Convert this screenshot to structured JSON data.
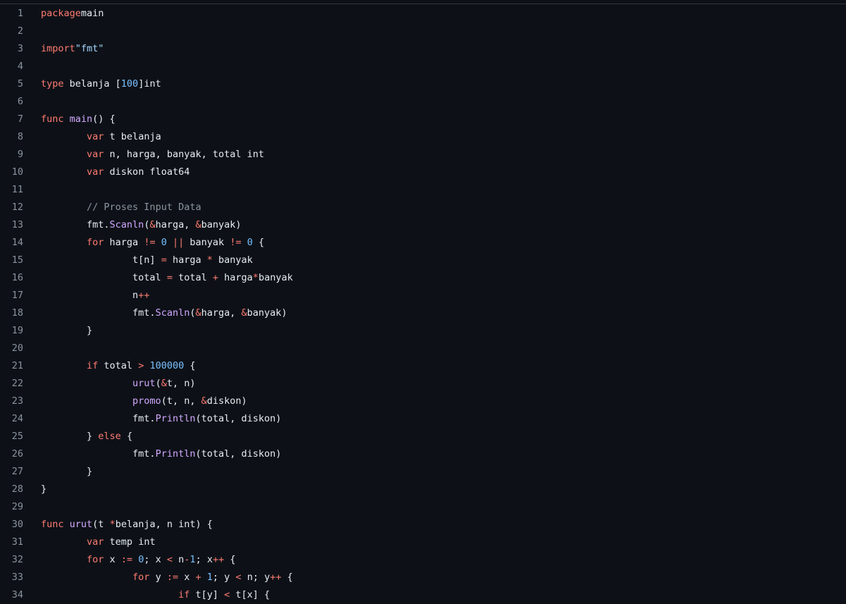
{
  "code": {
    "lines": [
      {
        "n": "1",
        "tokens": [
          [
            "kw",
            "package"
          ],
          [
            "",
            "main"
          ]
        ]
      },
      {
        "n": "2",
        "tokens": []
      },
      {
        "n": "3",
        "tokens": [
          [
            "kw",
            "import"
          ],
          [
            "str",
            "\"fmt\""
          ]
        ]
      },
      {
        "n": "4",
        "tokens": []
      },
      {
        "n": "5",
        "tokens": [
          [
            "kw",
            "type"
          ],
          [
            "",
            " belanja ["
          ],
          [
            "num",
            "100"
          ],
          [
            "",
            "]int"
          ]
        ]
      },
      {
        "n": "6",
        "tokens": []
      },
      {
        "n": "7",
        "tokens": [
          [
            "kw",
            "func"
          ],
          [
            "",
            " "
          ],
          [
            "fn",
            "main"
          ],
          [
            "",
            "() {"
          ]
        ]
      },
      {
        "n": "8",
        "tokens": [
          [
            "",
            "\t"
          ],
          [
            "kw",
            "var"
          ],
          [
            "",
            " t belanja"
          ]
        ]
      },
      {
        "n": "9",
        "tokens": [
          [
            "",
            "\t"
          ],
          [
            "kw",
            "var"
          ],
          [
            "",
            " n, harga, banyak, total int"
          ]
        ]
      },
      {
        "n": "10",
        "tokens": [
          [
            "",
            "\t"
          ],
          [
            "kw",
            "var"
          ],
          [
            "",
            " diskon float64"
          ]
        ]
      },
      {
        "n": "11",
        "tokens": []
      },
      {
        "n": "12",
        "tokens": [
          [
            "",
            "\t"
          ],
          [
            "cm",
            "// Proses Input Data"
          ]
        ]
      },
      {
        "n": "13",
        "tokens": [
          [
            "",
            "\tfmt."
          ],
          [
            "fn",
            "Scanln"
          ],
          [
            "",
            "("
          ],
          [
            "op",
            "&"
          ],
          [
            "",
            "harga, "
          ],
          [
            "op",
            "&"
          ],
          [
            "",
            "banyak)"
          ]
        ]
      },
      {
        "n": "14",
        "tokens": [
          [
            "",
            "\t"
          ],
          [
            "kw",
            "for"
          ],
          [
            "",
            " harga "
          ],
          [
            "op",
            "!="
          ],
          [
            "",
            " "
          ],
          [
            "num",
            "0"
          ],
          [
            "",
            " "
          ],
          [
            "op",
            "||"
          ],
          [
            "",
            " banyak "
          ],
          [
            "op",
            "!="
          ],
          [
            "",
            " "
          ],
          [
            "num",
            "0"
          ],
          [
            "",
            " {"
          ]
        ]
      },
      {
        "n": "15",
        "tokens": [
          [
            "",
            "\t\tt[n] "
          ],
          [
            "op",
            "="
          ],
          [
            "",
            " harga "
          ],
          [
            "op",
            "*"
          ],
          [
            "",
            " banyak"
          ]
        ]
      },
      {
        "n": "16",
        "tokens": [
          [
            "",
            "\t\ttotal "
          ],
          [
            "op",
            "="
          ],
          [
            "",
            " total "
          ],
          [
            "op",
            "+"
          ],
          [
            "",
            " harga"
          ],
          [
            "op",
            "*"
          ],
          [
            "",
            "banyak"
          ]
        ]
      },
      {
        "n": "17",
        "tokens": [
          [
            "",
            "\t\tn"
          ],
          [
            "op",
            "++"
          ]
        ]
      },
      {
        "n": "18",
        "tokens": [
          [
            "",
            "\t\tfmt."
          ],
          [
            "fn",
            "Scanln"
          ],
          [
            "",
            "("
          ],
          [
            "op",
            "&"
          ],
          [
            "",
            "harga, "
          ],
          [
            "op",
            "&"
          ],
          [
            "",
            "banyak)"
          ]
        ]
      },
      {
        "n": "19",
        "tokens": [
          [
            "",
            "\t}"
          ]
        ]
      },
      {
        "n": "20",
        "tokens": []
      },
      {
        "n": "21",
        "tokens": [
          [
            "",
            "\t"
          ],
          [
            "kw",
            "if"
          ],
          [
            "",
            " total "
          ],
          [
            "op",
            ">"
          ],
          [
            "",
            " "
          ],
          [
            "num",
            "100000"
          ],
          [
            "",
            " {"
          ]
        ]
      },
      {
        "n": "22",
        "tokens": [
          [
            "",
            "\t\t"
          ],
          [
            "fn",
            "urut"
          ],
          [
            "",
            "("
          ],
          [
            "op",
            "&"
          ],
          [
            "",
            "t, n)"
          ]
        ]
      },
      {
        "n": "23",
        "tokens": [
          [
            "",
            "\t\t"
          ],
          [
            "fn",
            "promo"
          ],
          [
            "",
            "(t, n, "
          ],
          [
            "op",
            "&"
          ],
          [
            "",
            "diskon)"
          ]
        ]
      },
      {
        "n": "24",
        "tokens": [
          [
            "",
            "\t\tfmt."
          ],
          [
            "fn",
            "Println"
          ],
          [
            "",
            "(total, diskon)"
          ]
        ]
      },
      {
        "n": "25",
        "tokens": [
          [
            "",
            "\t} "
          ],
          [
            "kw",
            "else"
          ],
          [
            "",
            " {"
          ]
        ]
      },
      {
        "n": "26",
        "tokens": [
          [
            "",
            "\t\tfmt."
          ],
          [
            "fn",
            "Println"
          ],
          [
            "",
            "(total, diskon)"
          ]
        ]
      },
      {
        "n": "27",
        "tokens": [
          [
            "",
            "\t}"
          ]
        ]
      },
      {
        "n": "28",
        "tokens": [
          [
            "",
            "}"
          ]
        ]
      },
      {
        "n": "29",
        "tokens": []
      },
      {
        "n": "30",
        "tokens": [
          [
            "kw",
            "func"
          ],
          [
            "",
            " "
          ],
          [
            "fn",
            "urut"
          ],
          [
            "",
            "(t "
          ],
          [
            "op",
            "*"
          ],
          [
            "",
            "belanja, n int) {"
          ]
        ]
      },
      {
        "n": "31",
        "tokens": [
          [
            "",
            "\t"
          ],
          [
            "kw",
            "var"
          ],
          [
            "",
            " temp int"
          ]
        ]
      },
      {
        "n": "32",
        "tokens": [
          [
            "",
            "\t"
          ],
          [
            "kw",
            "for"
          ],
          [
            "",
            " x "
          ],
          [
            "op",
            ":="
          ],
          [
            "",
            " "
          ],
          [
            "num",
            "0"
          ],
          [
            "",
            "; x "
          ],
          [
            "op",
            "<"
          ],
          [
            "",
            " n"
          ],
          [
            "op",
            "-"
          ],
          [
            "num",
            "1"
          ],
          [
            "",
            "; x"
          ],
          [
            "op",
            "++"
          ],
          [
            "",
            " {"
          ]
        ]
      },
      {
        "n": "33",
        "tokens": [
          [
            "",
            "\t\t"
          ],
          [
            "kw",
            "for"
          ],
          [
            "",
            " y "
          ],
          [
            "op",
            ":="
          ],
          [
            "",
            " x "
          ],
          [
            "op",
            "+"
          ],
          [
            "",
            " "
          ],
          [
            "num",
            "1"
          ],
          [
            "",
            "; y "
          ],
          [
            "op",
            "<"
          ],
          [
            "",
            " n; y"
          ],
          [
            "op",
            "++"
          ],
          [
            "",
            " {"
          ]
        ]
      },
      {
        "n": "34",
        "tokens": [
          [
            "",
            "\t\t\t"
          ],
          [
            "kw",
            "if"
          ],
          [
            "",
            " t[y] "
          ],
          [
            "op",
            "<"
          ],
          [
            "",
            " t[x] {"
          ]
        ]
      }
    ]
  }
}
